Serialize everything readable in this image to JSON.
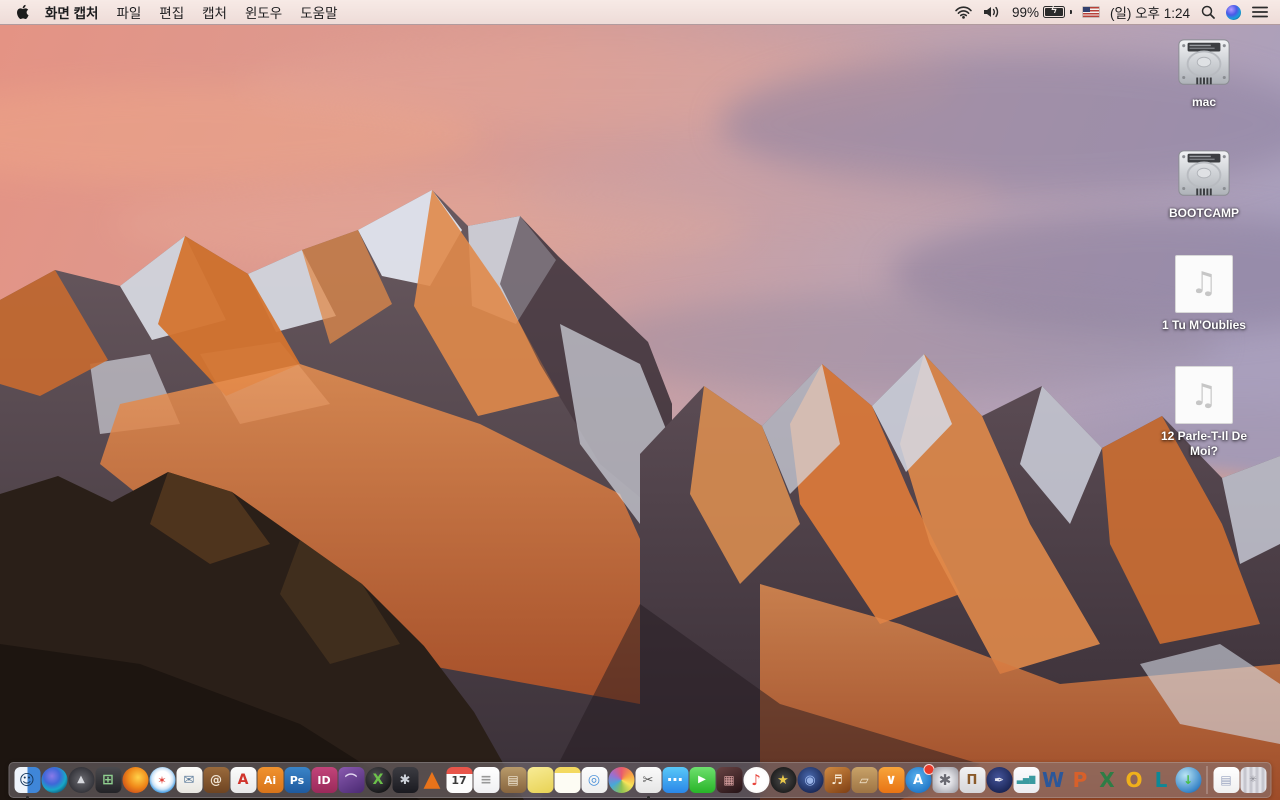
{
  "colors": {
    "menubar_bg": "#f3e2de",
    "dock_bg": "rgba(128,120,126,0.52)",
    "sky_left": "#e49384",
    "sky_right": "#a99fbc",
    "sunlit_rock": "#d4742f",
    "snow": "#e3e6ef",
    "foreground_rock": "#2a1f18"
  },
  "menu_bar": {
    "apple_logo": "apple",
    "app_name": "화면 캡처",
    "menus": [
      "파일",
      "편집",
      "캡처",
      "윈도우",
      "도움말"
    ],
    "status": {
      "wifi": "wifi-icon",
      "volume": "volume-icon",
      "battery_percent": "99%",
      "battery_charging": true,
      "input_source": "us-flag",
      "clock": "(일) 오후 1:24",
      "spotlight": "search-icon",
      "siri": "siri-icon",
      "notification_center": "list-icon"
    }
  },
  "desktop": {
    "icons": [
      {
        "id": "mac",
        "label": "mac",
        "type": "drive"
      },
      {
        "id": "bootcamp",
        "label": "BOOTCAMP",
        "type": "drive"
      },
      {
        "id": "audio-1",
        "label": "1 Tu M'Oublies",
        "type": "audio",
        "glyph": "♫"
      },
      {
        "id": "audio-12",
        "label": "12 Parle-T-Il De Moi?",
        "type": "audio",
        "glyph": "♫"
      }
    ]
  },
  "dock": {
    "items": [
      {
        "name": "finder",
        "bg": "linear-gradient(90deg,#eef4fb 47%,#3f86d8 53%)",
        "glyph": "☺",
        "color": "#16395f",
        "size": 15,
        "running": true
      },
      {
        "name": "siri",
        "bg": "radial-gradient(circle at 40% 35%,#8a7ae8 0%,#3f67d8 35%,#18a8c8 60%,#0c1f3f 95%)",
        "radius": "50%"
      },
      {
        "name": "launchpad",
        "bg": "radial-gradient(circle,#6a6a70 0%,#2e2e34 80%)",
        "radius": "50%",
        "glyph": "▲",
        "color": "#d8dadf",
        "size": 10
      },
      {
        "name": "mission-control",
        "bg": "linear-gradient(180deg,#4a4a4e,#232327)",
        "glyph": "⊞",
        "color": "#8fcf8f",
        "size": 14
      },
      {
        "name": "firefox",
        "bg": "radial-gradient(circle at 60% 40%,#ffd24a 0%,#f08a1a 45%,#d0561a 75%,#3a66a8 100%)",
        "radius": "50%"
      },
      {
        "name": "safari",
        "bg": "radial-gradient(circle at 50% 45%,#ffffff 0 38%,#cfe4f6 55%,#57a8e8 70%,#2a7fd0 100%)",
        "radius": "50%",
        "glyph": "✶",
        "color": "#e0443e",
        "size": 11
      },
      {
        "name": "mail-stamp",
        "bg": "linear-gradient(180deg,#fdfdfb,#e8e6e0)",
        "glyph": "✉",
        "color": "#5a7a9a",
        "size": 13
      },
      {
        "name": "contacts-book",
        "bg": "linear-gradient(180deg,#9a6a3c,#6e4422)",
        "glyph": "@",
        "color": "#f0e4d4",
        "size": 12
      },
      {
        "name": "acrobat-reader",
        "bg": "linear-gradient(180deg,#fbfbfb,#e8e8e8)",
        "glyph": "A",
        "color": "#d0342c",
        "size": 14
      },
      {
        "name": "illustrator",
        "bg": "linear-gradient(180deg,#f0922e,#d8741a)",
        "glyph": "Ai",
        "color": "#ffffff",
        "size": 11
      },
      {
        "name": "photoshop",
        "bg": "linear-gradient(180deg,#3a84c8,#1f5a9e)",
        "glyph": "Ps",
        "color": "#ffffff",
        "size": 11
      },
      {
        "name": "indesign",
        "bg": "linear-gradient(180deg,#c2447a,#9a2a5a)",
        "glyph": "ID",
        "color": "#ffffff",
        "size": 11
      },
      {
        "name": "toast-titanium",
        "bg": "linear-gradient(150deg,#8a5ab0,#4a2a72)",
        "glyph": "⌒",
        "color": "#e4d8f2",
        "size": 12
      },
      {
        "name": "green-x-sphere",
        "bg": "radial-gradient(circle at 40% 35%,#4e4e52,#141416 80%)",
        "radius": "50%",
        "glyph": "X",
        "color": "#6cc24a",
        "size": 14
      },
      {
        "name": "fan-drive-utility",
        "bg": "linear-gradient(180deg,#3c3c42,#1a1a20)",
        "glyph": "✱",
        "color": "#cdd2da",
        "size": 13
      },
      {
        "name": "vlc-cone",
        "bg": "transparent",
        "glyph": "▲",
        "color": "#e8731a",
        "size": 22
      },
      {
        "name": "calendar",
        "bg": "linear-gradient(180deg,#e8554a 0%,#e8554a 26%,#fdfdfd 26%)",
        "glyph": "17",
        "color": "#3a3a3a",
        "size": 11
      },
      {
        "name": "reminders",
        "bg": "linear-gradient(180deg,#ffffff,#f0f0f2)",
        "glyph": "≡",
        "color": "#999999",
        "size": 14
      },
      {
        "name": "archive-box",
        "bg": "linear-gradient(180deg,#b89a6a,#87653e)",
        "glyph": "▤",
        "color": "#f2ead8",
        "size": 12
      },
      {
        "name": "stickies",
        "bg": "linear-gradient(160deg,#f8ec96,#e8d254)"
      },
      {
        "name": "notes",
        "bg": "linear-gradient(180deg,#f3d960 0%,#f3d960 23%,#fdfcf4 23%)"
      },
      {
        "name": "preview",
        "bg": "linear-gradient(180deg,#fcfcfc,#eeeeee)",
        "glyph": "◎",
        "color": "#4a90d9",
        "size": 14
      },
      {
        "name": "photos",
        "bg": "conic-gradient(#e85a6e,#f8a145,#f8e45a,#8dc152,#48a8d8,#9a6fd0,#e85a6e)",
        "radius": "50%"
      },
      {
        "name": "grab-screen-capture",
        "bg": "linear-gradient(180deg,#fafafa,#e6e6e6)",
        "glyph": "✂",
        "color": "#555555",
        "size": 13,
        "running": true
      },
      {
        "name": "messages",
        "bg": "linear-gradient(180deg,#58c8f8,#2a86e8)",
        "glyph": "⋯",
        "color": "#ffffff",
        "size": 16
      },
      {
        "name": "facetime",
        "bg": "linear-gradient(180deg,#6ee06e,#28b428)",
        "glyph": "▶",
        "color": "#ffffff",
        "size": 10
      },
      {
        "name": "photo-booth",
        "bg": "linear-gradient(150deg,#6a4444,#241216)",
        "glyph": "▦",
        "color": "#d8a0a0",
        "size": 12
      },
      {
        "name": "itunes",
        "bg": "radial-gradient(circle,#ffffff 55%,#ececec)",
        "radius": "50%",
        "glyph": "♪",
        "color": "#e8453c",
        "size": 15
      },
      {
        "name": "imovie-star",
        "bg": "radial-gradient(circle,#4c4c4c,#161616 85%)",
        "radius": "50%",
        "glyph": "★",
        "color": "#e8c84a",
        "size": 13
      },
      {
        "name": "idvd",
        "bg": "radial-gradient(circle at 45% 40%,#4a6ab0,#14204a 85%)",
        "radius": "50%",
        "glyph": "◉",
        "color": "#9ab4e8",
        "size": 13
      },
      {
        "name": "garageband",
        "bg": "linear-gradient(150deg,#d08a42,#7e3f14)",
        "glyph": "♬",
        "color": "#f8ecd8",
        "size": 13
      },
      {
        "name": "corkboard-app",
        "bg": "linear-gradient(180deg,#c8a268,#9e7444)",
        "glyph": "▱",
        "color": "#f4e8d0",
        "size": 12
      },
      {
        "name": "ibooks",
        "bg": "linear-gradient(180deg,#f8a43a,#e87414)",
        "glyph": "∨",
        "color": "#ffffff",
        "size": 14
      },
      {
        "name": "app-store",
        "bg": "radial-gradient(circle at 45% 40%,#5ab4f0,#1a6ec0 85%)",
        "radius": "50%",
        "glyph": "A",
        "color": "#ffffff",
        "size": 13,
        "badge": true
      },
      {
        "name": "system-preferences",
        "bg": "radial-gradient(circle,#ececf0 25%,#9a9aa2 95%)",
        "glyph": "✱",
        "color": "#6a6a72",
        "size": 15
      },
      {
        "name": "keynote-podium",
        "bg": "linear-gradient(180deg,#f2f2f4,#d6d6da)",
        "glyph": "Π",
        "color": "#8a5a2a",
        "size": 13
      },
      {
        "name": "pages-inkwell",
        "bg": "radial-gradient(circle at 45% 40%,#44549a,#141e4a 85%)",
        "radius": "50%",
        "glyph": "✒",
        "color": "#e8e8f2",
        "size": 12
      },
      {
        "name": "numbers-chart",
        "bg": "linear-gradient(180deg,#fbfbfd,#ececf0)",
        "glyph": "▃▅▇",
        "color": "#3a9aa0",
        "size": 8
      },
      {
        "name": "word",
        "bg": "transparent",
        "glyph": "W",
        "color": "#2b579a",
        "size": 20
      },
      {
        "name": "powerpoint",
        "bg": "transparent",
        "glyph": "P",
        "color": "#d8602a",
        "size": 20
      },
      {
        "name": "excel",
        "bg": "transparent",
        "glyph": "X",
        "color": "#2e7d46",
        "size": 20
      },
      {
        "name": "outlook",
        "bg": "transparent",
        "glyph": "O",
        "color": "#f0b01a",
        "size": 20
      },
      {
        "name": "lync",
        "bg": "transparent",
        "glyph": "L",
        "color": "#0e8896",
        "size": 20
      },
      {
        "name": "globe-downloader",
        "bg": "radial-gradient(circle at 38% 32%,#b8e4f4,#3a86c8 70%,#1a4a88)",
        "radius": "50%",
        "glyph": "↓",
        "color": "#48c048",
        "size": 12
      },
      {
        "name": "dock-separator",
        "kind": "sep"
      },
      {
        "name": "document-file",
        "bg": "linear-gradient(180deg,#ffffff,#f0f0f0)",
        "glyph": "▤",
        "color": "#9aa4c0",
        "size": 12
      },
      {
        "name": "trash-full",
        "bg": "repeating-linear-gradient(90deg,#e2e2e8 0 3px,#c6c6ce 3px 6px)",
        "glyph": "✳",
        "color": "#8a8a92",
        "size": 9
      }
    ]
  }
}
